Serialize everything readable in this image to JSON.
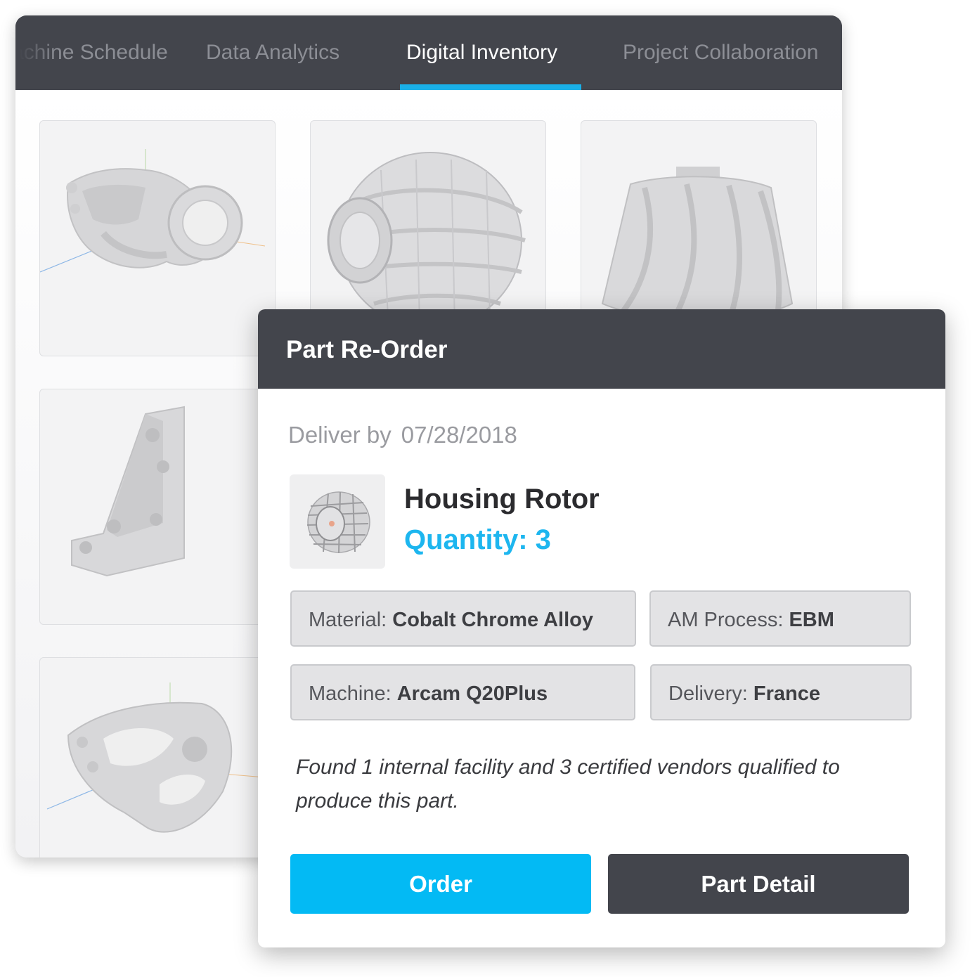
{
  "inventory": {
    "tabs": [
      {
        "label": "Machine Schedule"
      },
      {
        "label": "Data Analytics"
      },
      {
        "label": "Digital Inventory"
      },
      {
        "label": "Project Collaboration"
      }
    ],
    "active_tab": "Digital Inventory",
    "accent_color": "#1ab0e8",
    "parts": [
      {
        "icon": "bracket-part-icon"
      },
      {
        "icon": "rotor-cage-part-icon"
      },
      {
        "icon": "impeller-part-icon"
      },
      {
        "icon": "mount-bracket-part-icon"
      },
      {
        "icon": "housing-part-icon"
      }
    ]
  },
  "reorder": {
    "title": "Part Re-Order",
    "deliver_label": "Deliver by",
    "deliver_date": "07/28/2018",
    "part_name": "Housing Rotor",
    "quantity": "Quantity: 3",
    "specs": {
      "material_label": "Material:",
      "material_value": "Cobalt Chrome Alloy",
      "process_label": "AM Process:",
      "process_value": "EBM",
      "machine_label": "Machine:",
      "machine_value": "Arcam Q20Plus",
      "delivery_label": "Delivery:",
      "delivery_value": "France"
    },
    "found_text": "Found 1 internal facility and 3 certified vendors qualified to produce this part.",
    "order_button": "Order",
    "detail_button": "Part Detail",
    "colors": {
      "header": "#43454c",
      "quantity": "#1db6ef",
      "order_button": "#03baf4"
    }
  }
}
